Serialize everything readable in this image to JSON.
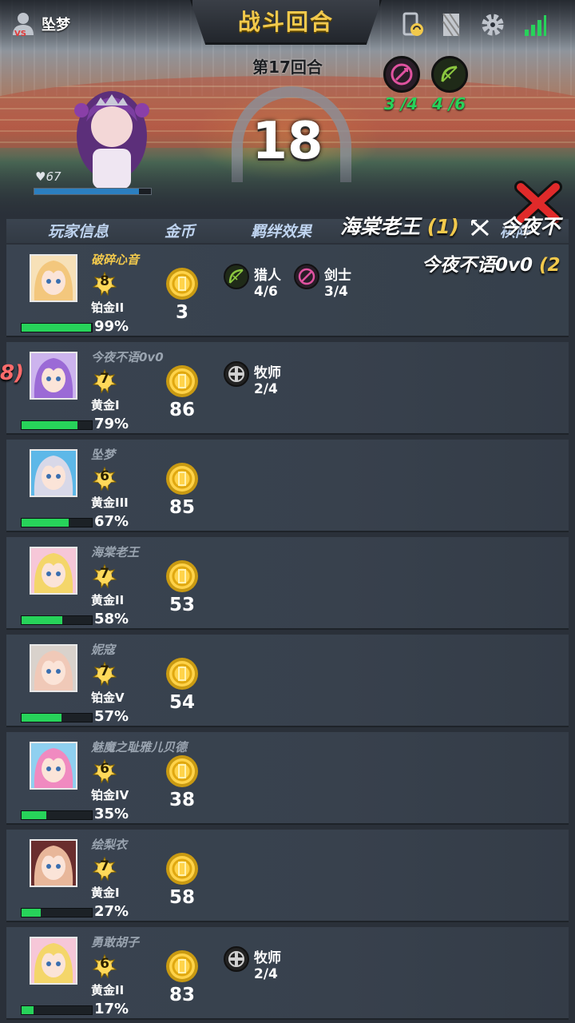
{
  "topbar": {
    "player_name": "坠梦",
    "title": "战斗回合",
    "round": "第17回合",
    "countdown": "18",
    "icons": [
      "swap-phone-icon",
      "card-icon",
      "gear-icon",
      "signal-icon"
    ]
  },
  "top_synergies": [
    {
      "icon": "sword-icon",
      "count": "3 /4",
      "color": "#e052a0",
      "count_color": "#27d35a"
    },
    {
      "icon": "bow-icon",
      "count": "4 /6",
      "color": "#8bc63f",
      "count_color": "#27d35a"
    }
  ],
  "opponent": {
    "hp": "67",
    "hp_fraction": 0.9
  },
  "battle": {
    "line1_name": "海棠老王",
    "line1_num": "(1)",
    "line1_vs": "今夜不",
    "line2_name": "今夜不语0v0",
    "line2_num": "(2",
    "left_fragment": "8)"
  },
  "headers": {
    "info": "玩家信息",
    "gold": "金币",
    "synergy": "羁绊效果",
    "lineup": "棋阵"
  },
  "colors": {
    "gold_text": "#f2c94c",
    "hp_green": "#27d35a",
    "panel": "#394350"
  },
  "players": [
    {
      "name": "破碎心音",
      "self": true,
      "level": "8",
      "rank": "铂金II",
      "pct_text": "99%",
      "pct": 0.99,
      "gold": "3",
      "avatar_hair": "#f3c77d",
      "avatar_bg": "#f7e1b8",
      "synergies": [
        {
          "icon": "bow-icon",
          "name": "猎人",
          "count": "4/6",
          "color": "#8bc63f"
        },
        {
          "icon": "sword-icon",
          "name": "剑士",
          "count": "3/4",
          "color": "#e052a0"
        }
      ]
    },
    {
      "name": "今夜不语0v0",
      "self": false,
      "level": "7",
      "rank": "黄金I",
      "pct_text": "79%",
      "pct": 0.79,
      "gold": "86",
      "avatar_hair": "#9b6ad6",
      "avatar_bg": "#cdb4ee",
      "synergies": [
        {
          "icon": "cross-icon",
          "name": "牧师",
          "count": "2/4",
          "color": "#cfcfcf"
        }
      ]
    },
    {
      "name": "坠梦",
      "self": false,
      "level": "6",
      "rank": "黄金III",
      "pct_text": "67%",
      "pct": 0.67,
      "gold": "85",
      "avatar_hair": "#d8d8e8",
      "avatar_bg": "#5db8e8",
      "synergies": []
    },
    {
      "name": "海棠老王",
      "self": false,
      "level": "7",
      "rank": "黄金II",
      "pct_text": "58%",
      "pct": 0.58,
      "gold": "53",
      "avatar_hair": "#f4d66a",
      "avatar_bg": "#f6c7d8",
      "synergies": []
    },
    {
      "name": "妮寇",
      "self": false,
      "level": "7",
      "rank": "铂金V",
      "pct_text": "57%",
      "pct": 0.57,
      "gold": "54",
      "avatar_hair": "#f0c9b8",
      "avatar_bg": "#d9d2cc",
      "synergies": []
    },
    {
      "name": "魅魔之耻雅儿贝德",
      "self": false,
      "level": "6",
      "rank": "铂金IV",
      "pct_text": "35%",
      "pct": 0.35,
      "gold": "38",
      "avatar_hair": "#f08ac0",
      "avatar_bg": "#8fd0f0",
      "synergies": []
    },
    {
      "name": "绘梨衣",
      "self": false,
      "level": "7",
      "rank": "黄金I",
      "pct_text": "27%",
      "pct": 0.27,
      "gold": "58",
      "avatar_hair": "#e8b79a",
      "avatar_bg": "#6a2e2e",
      "synergies": []
    },
    {
      "name": "勇敢胡子",
      "self": false,
      "level": "6",
      "rank": "黄金II",
      "pct_text": "17%",
      "pct": 0.17,
      "gold": "83",
      "avatar_hair": "#f4d66a",
      "avatar_bg": "#f6c7d8",
      "synergies": [
        {
          "icon": "cross-icon",
          "name": "牧师",
          "count": "2/4",
          "color": "#cfcfcf"
        }
      ]
    }
  ]
}
